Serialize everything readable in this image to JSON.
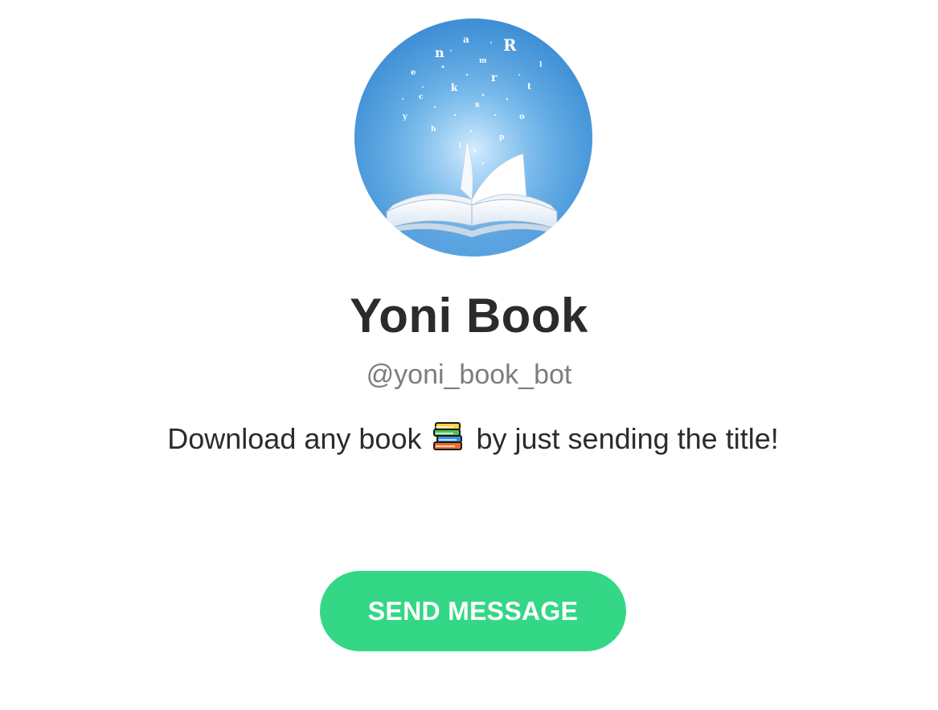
{
  "profile": {
    "name": "Yoni Book",
    "username": "@yoni_book_bot",
    "description_before": "Download any book",
    "description_after": "by just sending the title!",
    "description_icon": "books-icon",
    "avatar_icon": "open-book-flying-letters"
  },
  "actions": {
    "send_message_label": "SEND MESSAGE"
  },
  "colors": {
    "button": "#34d785",
    "title": "#2b2b2b",
    "username": "#7d7d7d",
    "avatar_bg": "#4a9be0"
  }
}
